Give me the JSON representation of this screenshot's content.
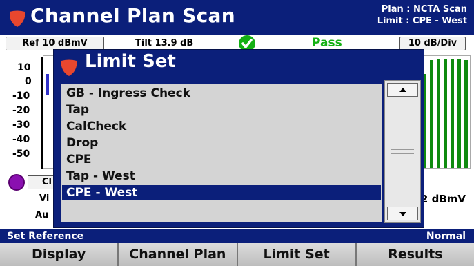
{
  "header": {
    "title": "Channel Plan Scan",
    "plan": "Plan : NCTA Scan",
    "limit": "Limit : CPE - West"
  },
  "info_row": {
    "reference": "Ref 10 dBmV",
    "tilt": "Tilt 13.9 dB",
    "result": "Pass",
    "scale": "10 dB/Div"
  },
  "spectrum": {
    "y_ticks": [
      "10",
      "0",
      "-10",
      "-20",
      "-30",
      "-40",
      "-50"
    ],
    "marker_label": "Cl",
    "video_label": "Vi",
    "audio_label": "Au",
    "level_text": "2 dBmV"
  },
  "status": {
    "left": "Set Reference",
    "right": "Normal"
  },
  "softkeys": [
    "Display",
    "Channel Plan",
    "Limit Set",
    "Results"
  ],
  "modal": {
    "title": "Limit Set",
    "items": [
      "GB - Ingress Check",
      "Tap",
      "CalCheck",
      "Drop",
      "CPE",
      "Tap - West",
      "CPE - West",
      ""
    ],
    "selected_item": "CPE - West"
  },
  "colors": {
    "header_blue": "#0b1f7a",
    "pass_green": "#14b014",
    "shield_red": "#e8472e",
    "bar_green": "#0f8a0f"
  },
  "icons": {
    "logo": "shield-icon",
    "pass_status": "check-circle-icon",
    "scroll_up": "triangle-up-icon",
    "scroll_down": "triangle-down-icon"
  }
}
